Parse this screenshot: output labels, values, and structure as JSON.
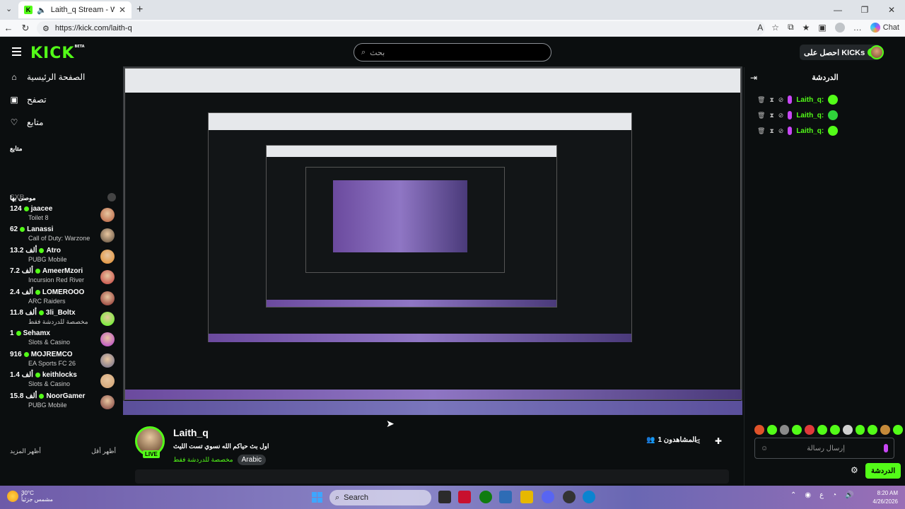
{
  "browser": {
    "tab_title": "Laith_q Stream - Watch Live o",
    "url": "https://kick.com/laith-q",
    "chat_label": "Chat"
  },
  "kick": {
    "logo": "KICK",
    "logo_badge": "BETA",
    "search_placeholder": "بحث",
    "get_kicks": "احصل على KICKs"
  },
  "sidebar": {
    "nav": [
      {
        "label": "الصفحة الرئيسية",
        "icon": "home-icon"
      },
      {
        "label": "تصفح",
        "icon": "browse-icon"
      },
      {
        "label": "متابع",
        "icon": "heart-icon"
      }
    ],
    "following_heading": "متابع",
    "following_item": "SXB",
    "recommended_heading": "موصى بها",
    "recommended": [
      {
        "viewers": "124",
        "name": "jaacee",
        "category": "Toilet 8",
        "color": "#b45a3a"
      },
      {
        "viewers": "62",
        "name": "Lanassi",
        "category": "Call of Duty: Warzone",
        "color": "#5a4a3a"
      },
      {
        "viewers": "13.2 ألف",
        "name": "Atro",
        "category": "PUBG Mobile",
        "color": "#e08a2a"
      },
      {
        "viewers": "7.2 ألف",
        "name": "AmeerMzori",
        "category": "Incursion Red River",
        "color": "#c23a3a"
      },
      {
        "viewers": "2.4 ألف",
        "name": "LOMEROOO",
        "category": "ARC Raiders",
        "color": "#8a2a2a"
      },
      {
        "viewers": "11.8 ألف",
        "name": "3li_Boltx",
        "category": "مخصصة للدردشة فقط",
        "color": "#53fc18"
      },
      {
        "viewers": "1",
        "name": "Sehamx",
        "category": "Slots & Casino",
        "color": "#b43ad0"
      },
      {
        "viewers": "916",
        "name": "MOJREMCO",
        "category": "EA Sports FC 26",
        "color": "#6a6a8a"
      },
      {
        "viewers": "1.4 ألف",
        "name": "keithlocks",
        "category": "Slots & Casino",
        "color": "#d0a070"
      },
      {
        "viewers": "15.8 ألف",
        "name": "NoorGamer",
        "category": "PUBG Mobile",
        "color": "#7a3a3a"
      }
    ],
    "show_more": "أظهر المزيد",
    "show_less": "أظهر أقل"
  },
  "stream": {
    "streamer": "Laith_q",
    "live": "LIVE",
    "title": "اول بث حياكم الله نسوي تست الليث",
    "category": "مخصصة للدردشة فقط",
    "language": "Arabic",
    "viewers": "المشاهدون 1"
  },
  "chat": {
    "title": "الدردشة",
    "messages": [
      {
        "user": "Laith_q:",
        "emote_color": "#53fc18"
      },
      {
        "user": "Laith_q:",
        "emote_color": "#2fd33a"
      },
      {
        "user": "Laith_q:",
        "emote_color": "#53fc18"
      }
    ],
    "input_placeholder": "إرسال رسالة",
    "send_label": "الدردشة",
    "emote_colors": [
      "#e0532a",
      "#53fc18",
      "#8a8a8a",
      "#53fc18",
      "#e03a3a",
      "#53fc18",
      "#53fc18",
      "#d0d0d0",
      "#53fc18",
      "#53fc18",
      "#c58a3a",
      "#53fc18"
    ]
  },
  "taskbar": {
    "weather_temp": "30°C",
    "weather_desc": "مشمس جزئياً",
    "search": "Search",
    "time": "8:20 AM",
    "date": "4/26/2026"
  }
}
